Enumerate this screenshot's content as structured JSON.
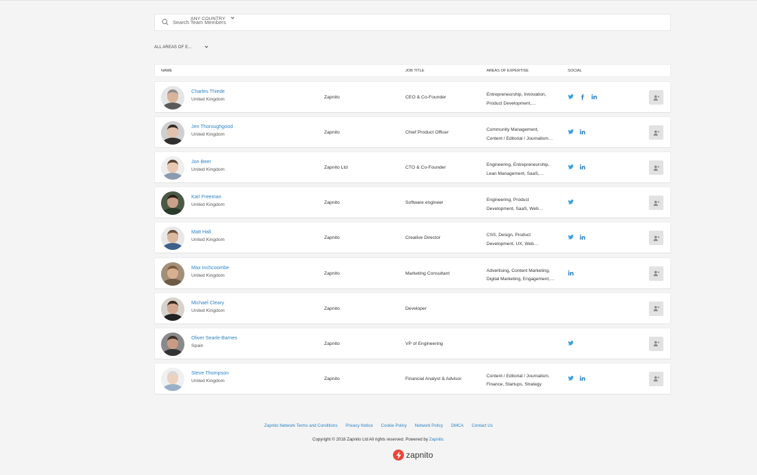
{
  "search": {
    "placeholder": "Search Team Members"
  },
  "filters": {
    "area": "ALL AREAS OF E...",
    "country": "ANY COUNTRY"
  },
  "columns": {
    "name": "NAME",
    "job_title": "JOB TITLE",
    "expertise": "AREAS OF EXPERTISE",
    "social": "SOCIAL"
  },
  "members": [
    {
      "name": "Charles Thiede",
      "country": "United Kingdom",
      "company": "Zapnito",
      "title": "CEO & Co-Founder",
      "expertise": [
        "Entrepreneurship, Innovation,",
        "Product Development,…"
      ],
      "social": [
        "twitter",
        "facebook",
        "linkedin"
      ]
    },
    {
      "name": "Jen Thoroughgood",
      "country": "United Kingdom",
      "company": "Zapnito",
      "title": "Chief Product Officer",
      "expertise": [
        "Community Management,",
        "Content / Editorial / Journalism…"
      ],
      "social": [
        "twitter",
        "linkedin"
      ]
    },
    {
      "name": "Jon Beer",
      "country": "United Kingdom",
      "company": "Zapnito Ltd",
      "title": "CTO & Co-Founder",
      "expertise": [
        "Engineering, Entrepreneurship,",
        "Lean Management, SaaS,…"
      ],
      "social": [
        "twitter",
        "linkedin"
      ]
    },
    {
      "name": "Karl Freeman",
      "country": "United Kingdom",
      "company": "Zapnito",
      "title": "Software engineer",
      "expertise": [
        "Engineering, Product",
        "Development, SaaS, Web…"
      ],
      "social": [
        "twitter"
      ]
    },
    {
      "name": "Matt Hall",
      "country": "United Kingdom",
      "company": "Zapnito",
      "title": "Creative Director",
      "expertise": [
        "CSS, Design, Product",
        "Development, UX, Web…"
      ],
      "social": [
        "twitter",
        "linkedin"
      ]
    },
    {
      "name": "Max Inchcoombe",
      "country": "United Kingdom",
      "company": "Zapnito",
      "title": "Marketing Consultant",
      "expertise": [
        "Advertising, Content Marketing,",
        "Digital Marketing, Engagement,…"
      ],
      "social": [
        "linkedin"
      ]
    },
    {
      "name": "Michael Cleary",
      "country": "United Kingdom",
      "company": "Zapnito",
      "title": "Developer",
      "expertise": [],
      "social": []
    },
    {
      "name": "Oliver Searle-Barnes",
      "country": "Spain",
      "company": "Zapnito",
      "title": "VP of Engineering",
      "expertise": [],
      "social": [
        "twitter"
      ]
    },
    {
      "name": "Steve Thompson",
      "country": "United Kingdom",
      "company": "Zapnito",
      "title": "Financial Analyst & Advisor",
      "expertise": [
        "Content / Editorial / Journalism,",
        "Finance, Startups, Strategy"
      ],
      "social": [
        "twitter",
        "linkedin"
      ]
    }
  ],
  "avatars": [
    {
      "skin": "#d9b49a",
      "hair": "#8c8c8c",
      "shirt": "#5a5a5a",
      "bg": "#e5e5e5"
    },
    {
      "skin": "#e2c2ad",
      "hair": "#3a2a22",
      "shirt": "#2f2f2f",
      "bg": "#cfcfcf"
    },
    {
      "skin": "#e8c8b0",
      "hair": "#5a4636",
      "shirt": "#8a9bb0",
      "bg": "#eeeeee"
    },
    {
      "skin": "#c9a088",
      "hair": "#2b2118",
      "shirt": "#2a3a2a",
      "bg": "#4b5a45"
    },
    {
      "skin": "#dbb8a0",
      "hair": "#6a5240",
      "shirt": "#3d5f8a",
      "bg": "#e8e8e8"
    },
    {
      "skin": "#d8b090",
      "hair": "#7a5a3a",
      "shirt": "#6b5a45",
      "bg": "#a38f78"
    },
    {
      "skin": "#d2a890",
      "hair": "#3a2a20",
      "shirt": "#222222",
      "bg": "#d6d2cc"
    },
    {
      "skin": "#c89c84",
      "hair": "#3b3028",
      "shirt": "#333333",
      "bg": "#8a8a8a"
    },
    {
      "skin": "#ecd0c0",
      "hair": "#d8d8d8",
      "shirt": "#9ab0c8",
      "bg": "#f0f0f0"
    }
  ],
  "footer": {
    "links": [
      "Zapnito Network Terms and Conditions",
      "Privacy Notice",
      "Cookie Policy",
      "Network Policy",
      "DMCA",
      "Contact Us"
    ],
    "copyright": "Copyright © 2018 Zapnito Ltd All rights reserved. Powered by",
    "powered_by": "Zapnito.",
    "logo_text": "zapnito"
  },
  "colors": {
    "link": "#2b83c6",
    "twitter": "#3b9ee0",
    "linkedin": "#2b83c6",
    "facebook": "#2b83c6",
    "brand": "#e8463c"
  }
}
